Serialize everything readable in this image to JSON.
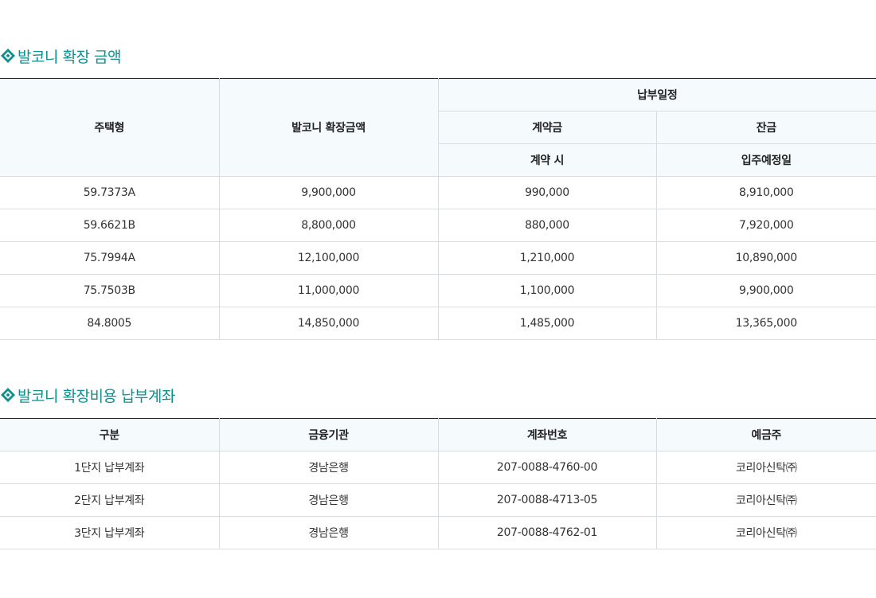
{
  "section1": {
    "title": "발코니 확장 금액",
    "headers": {
      "type": "주택형",
      "amount": "발코니 확장금액",
      "schedule": "납부일정",
      "deposit": "계약금",
      "balance": "잔금",
      "deposit_when": "계약 시",
      "balance_when": "입주예정일"
    },
    "rows": [
      {
        "type": "59.7373A",
        "amount": "9,900,000",
        "deposit": "990,000",
        "balance": "8,910,000"
      },
      {
        "type": "59.6621B",
        "amount": "8,800,000",
        "deposit": "880,000",
        "balance": "7,920,000"
      },
      {
        "type": "75.7994A",
        "amount": "12,100,000",
        "deposit": "1,210,000",
        "balance": "10,890,000"
      },
      {
        "type": "75.7503B",
        "amount": "11,000,000",
        "deposit": "1,100,000",
        "balance": "9,900,000"
      },
      {
        "type": "84.8005",
        "amount": "14,850,000",
        "deposit": "1,485,000",
        "balance": "13,365,000"
      }
    ]
  },
  "section2": {
    "title": "발코니 확장비용 납부계좌",
    "headers": {
      "category": "구분",
      "bank": "금융기관",
      "account": "계좌번호",
      "holder": "예금주"
    },
    "rows": [
      {
        "category": "1단지 납부계좌",
        "bank": "경남은행",
        "account": "207-0088-4760-00",
        "holder": "코리아신탁㈜"
      },
      {
        "category": "2단지 납부계좌",
        "bank": "경남은행",
        "account": "207-0088-4713-05",
        "holder": "코리아신탁㈜"
      },
      {
        "category": "3단지 납부계좌",
        "bank": "경남은행",
        "account": "207-0088-4762-01",
        "holder": "코리아신탁㈜"
      }
    ]
  },
  "colors": {
    "accent": "#0f8f8f",
    "header_bg": "#f5fafd",
    "border": "#d9dde2",
    "top_border": "#1e2a33"
  }
}
